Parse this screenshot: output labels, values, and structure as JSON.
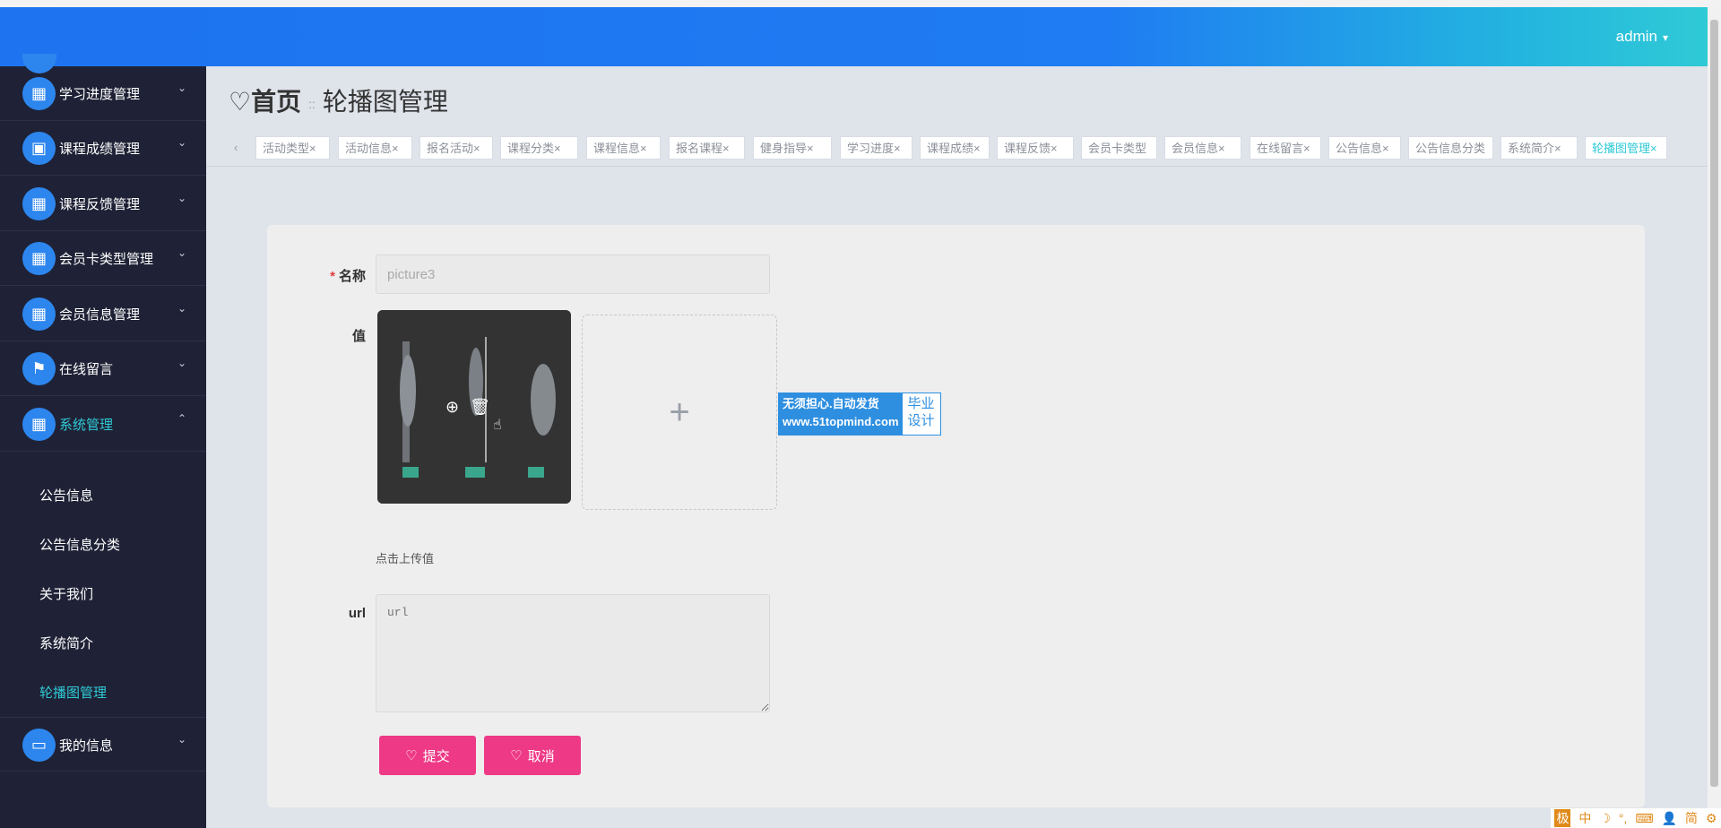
{
  "header": {
    "user": "admin",
    "caret": "▾"
  },
  "breadcrumb": {
    "home": "首页",
    "separator": "::",
    "current": "轮播图管理",
    "icon": "heart-outline-icon"
  },
  "sidebar": {
    "items": [
      {
        "label": "学习进度管理",
        "icon": "grid-icon",
        "arrow": "⌄"
      },
      {
        "label": "课程成绩管理",
        "icon": "clipboard-check-icon",
        "arrow": "⌄"
      },
      {
        "label": "课程反馈管理",
        "icon": "apps-icon",
        "arrow": "⌄"
      },
      {
        "label": "会员卡类型管理",
        "icon": "apps-icon",
        "arrow": "⌄"
      },
      {
        "label": "会员信息管理",
        "icon": "apps-icon",
        "arrow": "⌄"
      },
      {
        "label": "在线留言",
        "icon": "flag-icon",
        "arrow": "⌄"
      },
      {
        "label": "系统管理",
        "icon": "apps-icon",
        "arrow": "⌃"
      },
      {
        "label": "我的信息",
        "icon": "wallet-icon",
        "arrow": "⌄"
      }
    ],
    "submenu": [
      "公告信息",
      "公告信息分类",
      "关于我们",
      "系统简介",
      "轮播图管理"
    ]
  },
  "tags": {
    "prev": "‹",
    "items": [
      "活动类型",
      "活动信息",
      "报名活动",
      "课程分类",
      "课程信息",
      "报名课程",
      "健身指导",
      "学习进度",
      "课程成绩",
      "课程反馈",
      "会员卡类型",
      "会员信息",
      "在线留言",
      "公告信息",
      "公告信息分类",
      "系统简介",
      "轮播图管理"
    ],
    "active": "轮播图管理"
  },
  "form": {
    "name_label": "名称",
    "required_mark": "*",
    "name_value": "picture3",
    "value_label": "值",
    "upload_plus": "+",
    "upload_hint": "点击上传值",
    "url_label": "url",
    "url_placeholder": "url",
    "submit_label": "提交",
    "cancel_label": "取消"
  },
  "watermark": {
    "line1": "无须担心.自动发货",
    "line2": "www.51topmind.com",
    "right1": "毕业",
    "right2": "设计"
  },
  "ime": {
    "k": "极",
    "zh": "中",
    "moon": "☽",
    "dots": "°,",
    "kb": "⌨",
    "user": "👤",
    "simp": "简",
    "gear": "⚙"
  },
  "colors": {
    "header_start": "#1e73f0",
    "header_end": "#2fcad6",
    "sidebar": "#1f2236",
    "accent": "#2fcad6",
    "button": "#ee3a86"
  }
}
